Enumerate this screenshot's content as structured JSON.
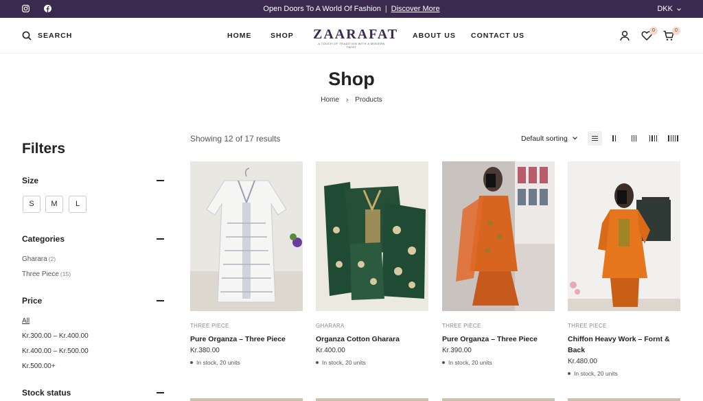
{
  "topbar": {
    "promo_text": "Open Doors To A World Of Fashion",
    "promo_link": "Discover More",
    "currency": "DKK",
    "social_icons": [
      "instagram-icon",
      "facebook-icon"
    ]
  },
  "header": {
    "search_label": "SEARCH",
    "nav": [
      "HOME",
      "SHOP",
      "ABOUT US",
      "CONTACT US"
    ],
    "logo_name": "ZAARAFAT",
    "logo_tagline": "A TOUCH OF TRADITION WITH A MODERN TWIST",
    "wishlist_count": "0",
    "cart_count": "0"
  },
  "page": {
    "title": "Shop",
    "breadcrumb": [
      "Home",
      "Products"
    ],
    "breadcrumb_sep": "›"
  },
  "filters": {
    "title": "Filters",
    "size": {
      "title": "Size",
      "options": [
        "S",
        "M",
        "L"
      ]
    },
    "categories": {
      "title": "Categories",
      "items": [
        {
          "label": "Gharara",
          "count": "(2)"
        },
        {
          "label": "Three Piece",
          "count": "(15)"
        }
      ]
    },
    "price": {
      "title": "Price",
      "items": [
        "All",
        "Kr.300.00 – Kr.400.00",
        "Kr.400.00 – Kr.500.00",
        "Kr.500.00+"
      ]
    },
    "stock": {
      "title": "Stock status"
    }
  },
  "toolbar": {
    "showing": "Showing 12 of 17 results",
    "sorting": "Default sorting",
    "views": [
      "list",
      "2-columns",
      "3-columns",
      "4-columns",
      "5-columns"
    ],
    "active_view": "list"
  },
  "products": [
    {
      "category": "THREE PIECE",
      "name": "Pure Organza – Three Piece",
      "price": "Kr.380.00",
      "stock": "In stock, 20 units"
    },
    {
      "category": "GHARARA",
      "name": "Organza Cotton Gharara",
      "price": "Kr.400.00",
      "stock": "In stock, 20 units"
    },
    {
      "category": "THREE PIECE",
      "name": "Pure Organza – Three Piece",
      "price": "Kr.390.00",
      "stock": "In stock, 20 units"
    },
    {
      "category": "THREE PIECE",
      "name": "Chiffon Heavy Work – Fornt & Back",
      "price": "Kr.480.00",
      "stock": "In stock, 20 units"
    }
  ],
  "colors": {
    "topbar_bg": "#3b2a4f",
    "stock_dot": "#2e6b3a",
    "badge_bg": "#f3d9cf"
  }
}
